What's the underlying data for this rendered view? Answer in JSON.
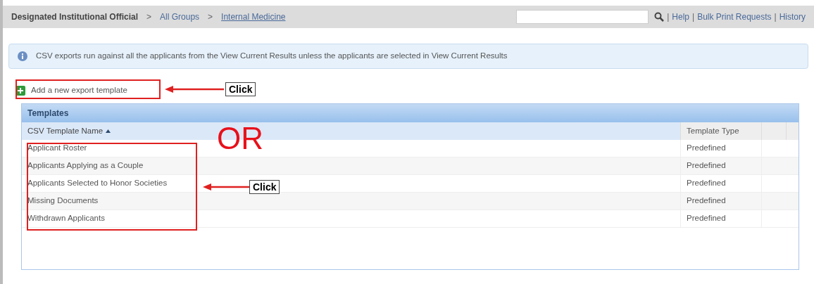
{
  "breadcrumb": [
    {
      "label": "Designated Institutional Official",
      "kind": "title"
    },
    {
      "label": "All Groups",
      "kind": "link"
    },
    {
      "label": "Internal Medicine",
      "kind": "current"
    }
  ],
  "breadcrumb_separators": [
    ">",
    ">"
  ],
  "top_links": [
    "Help",
    "Bulk Print Requests",
    "History"
  ],
  "link_separators": [
    "|",
    "|",
    "|"
  ],
  "info": "CSV exports run against all the applicants from the View Current Results unless the applicants are selected in View Current Results",
  "add_template": "Add a new export template",
  "table": {
    "title": "Templates",
    "columns": [
      {
        "label": "CSV Template Name",
        "sorted": true
      },
      {
        "label": "Template Type",
        "sorted": false
      }
    ],
    "rows": [
      {
        "name": "Applicant Roster",
        "type": "Predefined"
      },
      {
        "name": "Applicants Applying as a Couple",
        "type": "Predefined"
      },
      {
        "name": "Applicants Selected to Honor Societies",
        "type": "Predefined"
      },
      {
        "name": "Missing Documents",
        "type": "Predefined"
      },
      {
        "name": "Withdrawn Applicants",
        "type": "Predefined"
      }
    ]
  },
  "annotations": {
    "click_labels": [
      "Click",
      "Click"
    ],
    "or_label": "OR"
  }
}
